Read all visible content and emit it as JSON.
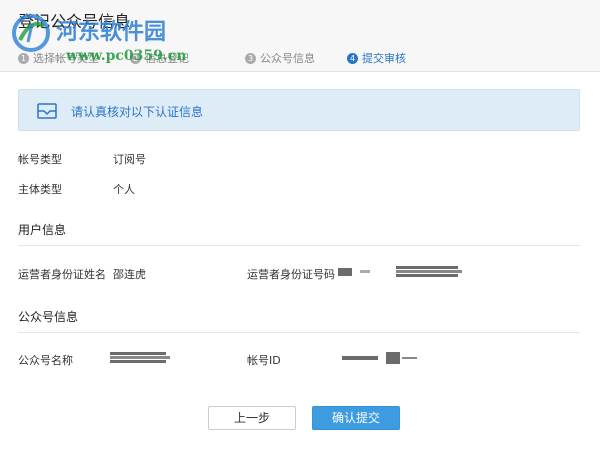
{
  "header": {
    "title": "登记公众号信息",
    "steps": [
      {
        "num": "1",
        "label": "选择帐号类型"
      },
      {
        "num": "2",
        "label": "信息登记"
      },
      {
        "num": "3",
        "label": "公众号信息"
      },
      {
        "num": "4",
        "label": "提交审核"
      }
    ]
  },
  "watermark": {
    "text": "河东软件园",
    "url": "www.pc0359.cn"
  },
  "notice": {
    "text": "请认真核对以下认证信息"
  },
  "account": {
    "type_label": "帐号类型",
    "type_value": "订阅号",
    "subject_label": "主体类型",
    "subject_value": "个人"
  },
  "user_info": {
    "heading": "用户信息",
    "name_label": "运营者身份证姓名",
    "name_value": "邵连虎",
    "id_label": "运营者身份证号码"
  },
  "official_info": {
    "heading": "公众号信息",
    "name_label": "公众号名称",
    "account_id_label": "帐号ID"
  },
  "buttons": {
    "prev": "上一步",
    "confirm": "确认提交"
  },
  "colors": {
    "accent": "#2a76c6",
    "notice_bg": "#ddecf7",
    "confirm_bg": "#3d9be0"
  }
}
